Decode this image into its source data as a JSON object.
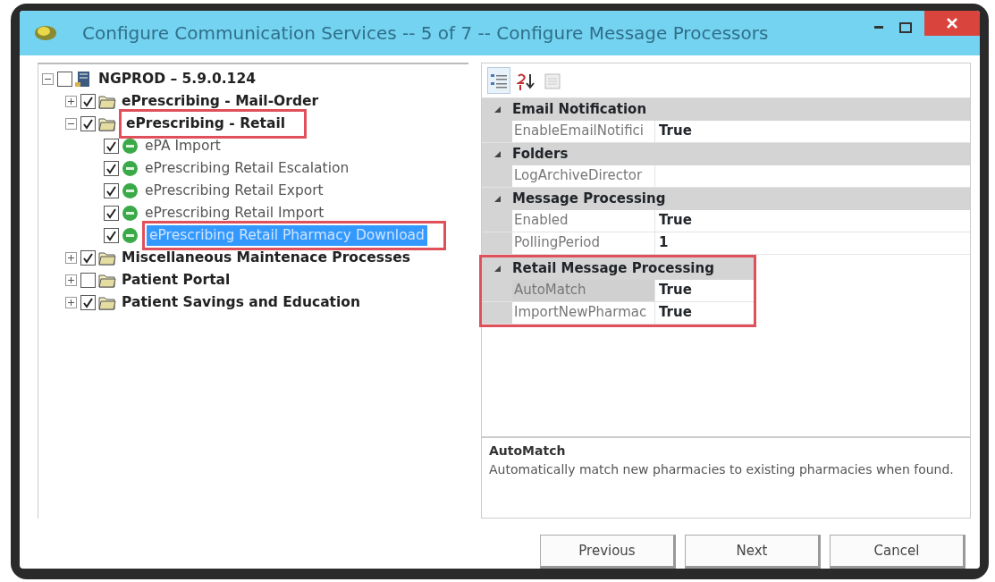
{
  "window": {
    "title": "Configure Communication Services -- 5 of 7 -- Configure Message Processors"
  },
  "tree": {
    "label": "NGPROD – 5.9.0.124",
    "kind": "server",
    "checked": false,
    "expanded": true,
    "selected": false,
    "children": [
      {
        "label": "ePrescribing - Mail-Order",
        "kind": "group",
        "checked": true,
        "expanded": false,
        "selected": false
      },
      {
        "label": "ePrescribing - Retail",
        "kind": "group",
        "checked": true,
        "expanded": true,
        "highlighted": true,
        "selected": false,
        "children": [
          {
            "label": "ePA Import",
            "kind": "processor",
            "checked": true,
            "selected": false
          },
          {
            "label": "ePrescribing Retail Escalation",
            "kind": "processor",
            "checked": true,
            "selected": false
          },
          {
            "label": "ePrescribing Retail Export",
            "kind": "processor",
            "checked": true,
            "selected": false
          },
          {
            "label": "ePrescribing Retail Import",
            "kind": "processor",
            "checked": true,
            "selected": false
          },
          {
            "label": "ePrescribing Retail Pharmacy Download",
            "kind": "processor",
            "checked": true,
            "highlighted": true,
            "selected": true
          }
        ]
      },
      {
        "label": "Miscellaneous Maintenace Processes",
        "kind": "group",
        "checked": true,
        "expanded": false,
        "selected": false
      },
      {
        "label": "Patient Portal",
        "kind": "group",
        "checked": false,
        "expanded": false,
        "selected": false
      },
      {
        "label": "Patient Savings and Education",
        "kind": "group",
        "checked": true,
        "expanded": false,
        "selected": false
      }
    ]
  },
  "toolbar": [
    {
      "kind": "categorized",
      "selected": true
    },
    {
      "kind": "alphabetical",
      "selected": false
    },
    {
      "kind": "pages",
      "selected": false
    }
  ],
  "categories": [
    {
      "name": "Email Notification",
      "properties": [
        {
          "name": "EnableEmailNotifici",
          "value": "True",
          "selected": false
        }
      ]
    },
    {
      "name": "Folders",
      "properties": [
        {
          "name": "LogArchiveDirector",
          "selected": false
        }
      ]
    },
    {
      "name": "Message Processing",
      "properties": [
        {
          "name": "Enabled",
          "value": "True",
          "selected": false
        },
        {
          "name": "PollingPeriod",
          "value": "1",
          "selected": false
        }
      ]
    },
    {
      "name": "Retail Message Processing",
      "highlighted": true,
      "properties": [
        {
          "name": "AutoMatch",
          "value": "True",
          "selected": true
        },
        {
          "name": "ImportNewPharmac",
          "value": "True",
          "selected": false
        }
      ]
    }
  ],
  "description": {
    "title": "AutoMatch",
    "text": "Automatically match new pharmacies to existing pharmacies when found."
  },
  "buttons": [
    "Previous",
    "Next",
    "Cancel"
  ]
}
